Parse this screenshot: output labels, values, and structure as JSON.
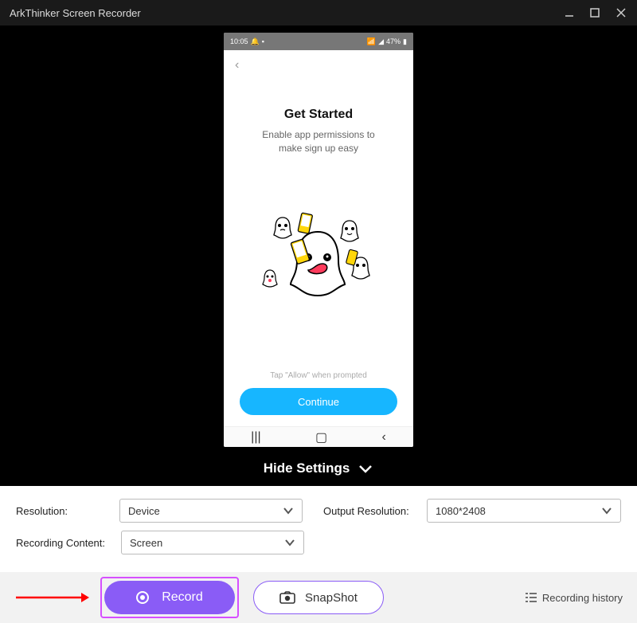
{
  "titlebar": {
    "title": "ArkThinker Screen Recorder"
  },
  "phone": {
    "statusbar": {
      "time": "10:05",
      "battery": "47%"
    },
    "heading": "Get Started",
    "subline1": "Enable app permissions to",
    "subline2": "make sign up easy",
    "tapmsg": "Tap \"Allow\" when prompted",
    "continue": "Continue"
  },
  "hideSettings": "Hide Settings",
  "settings": {
    "resolutionLabel": "Resolution:",
    "resolutionValue": "Device",
    "outputLabel": "Output Resolution:",
    "outputValue": "1080*2408",
    "contentLabel": "Recording Content:",
    "contentValue": "Screen"
  },
  "actions": {
    "record": "Record",
    "snapshot": "SnapShot",
    "history": "Recording history"
  }
}
